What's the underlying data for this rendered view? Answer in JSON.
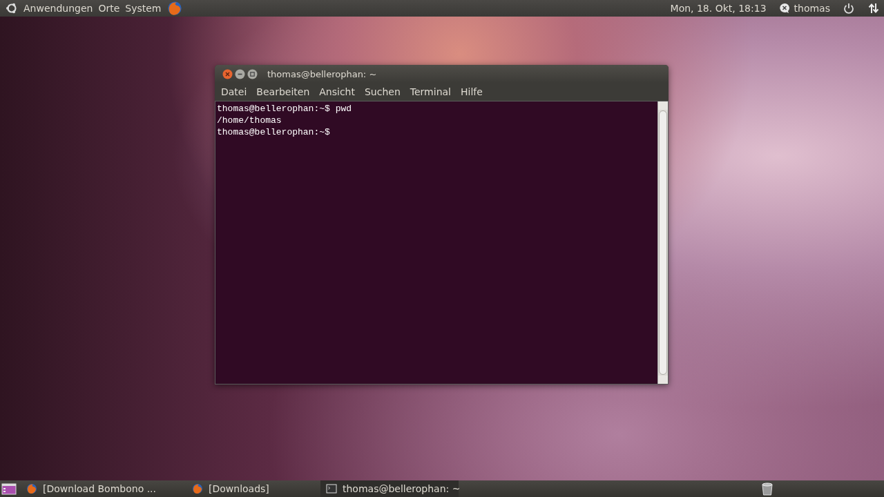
{
  "top_panel": {
    "menus": [
      "Anwendungen",
      "Orte",
      "System"
    ],
    "clock": "Mon, 18. Okt, 18:13",
    "user": "thomas"
  },
  "window": {
    "title": "thomas@bellerophan: ~",
    "menu": [
      "Datei",
      "Bearbeiten",
      "Ansicht",
      "Suchen",
      "Terminal",
      "Hilfe"
    ],
    "lines": [
      "thomas@bellerophan:~$ pwd",
      "/home/thomas",
      "thomas@bellerophan:~$"
    ]
  },
  "taskbar": [
    {
      "kind": "browser",
      "label": "[Download Bombono ...",
      "selected": false
    },
    {
      "kind": "browser",
      "label": "[Downloads]",
      "selected": false
    },
    {
      "kind": "terminal",
      "label": "thomas@bellerophan: ~",
      "selected": true
    }
  ]
}
